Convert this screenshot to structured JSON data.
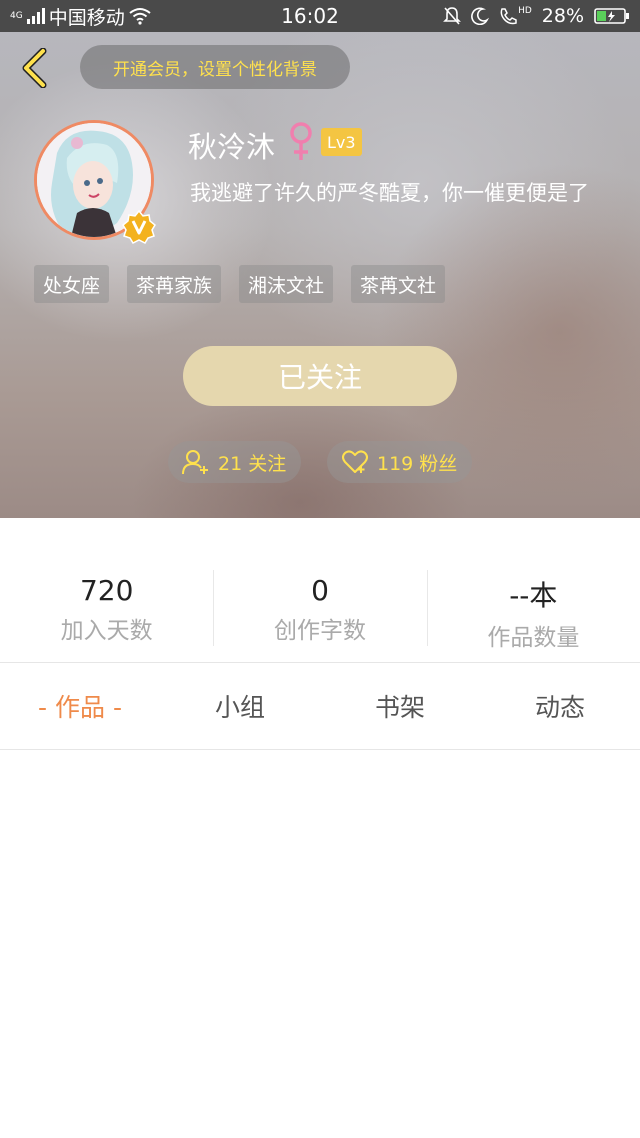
{
  "status_bar": {
    "network_badge": "4G",
    "carrier": "中国移动",
    "time": "16:02",
    "hd_badge": "HD",
    "battery": "28%"
  },
  "header": {
    "promo_text": "开通会员，设置个性化背景",
    "nickname": "秋泠沐",
    "level": "Lv3",
    "signature": "我逃避了许久的严冬酷夏，你一催更便是了",
    "tags": [
      "处女座",
      "茶苒家族",
      "湘沫文社",
      "茶苒文社"
    ],
    "follow_button_label": "已关注",
    "following_count": "21 关注",
    "fans_count": "119 粉丝",
    "colors": {
      "promo_text": "#ffe14d",
      "follow_button": "#e5d7ae",
      "level_badge": "#f4c542",
      "avatar_ring": "#ef8a63"
    }
  },
  "stats": [
    {
      "value": "720",
      "label": "加入天数"
    },
    {
      "value": "0",
      "label": "创作字数"
    },
    {
      "value": "--本",
      "label": "作品数量"
    }
  ],
  "tabs": [
    {
      "label": "- 作品 -",
      "active": true
    },
    {
      "label": "小组",
      "active": false
    },
    {
      "label": "书架",
      "active": false
    },
    {
      "label": "动态",
      "active": false
    }
  ],
  "icons": [
    "back-chevron-icon",
    "female-icon",
    "v-badge-icon",
    "user-add-icon",
    "heart-icon",
    "wifi-icon",
    "mute-bell-icon",
    "moon-icon",
    "phone-hd-icon",
    "battery-icon"
  ],
  "accent_color": "#ef8a4a"
}
